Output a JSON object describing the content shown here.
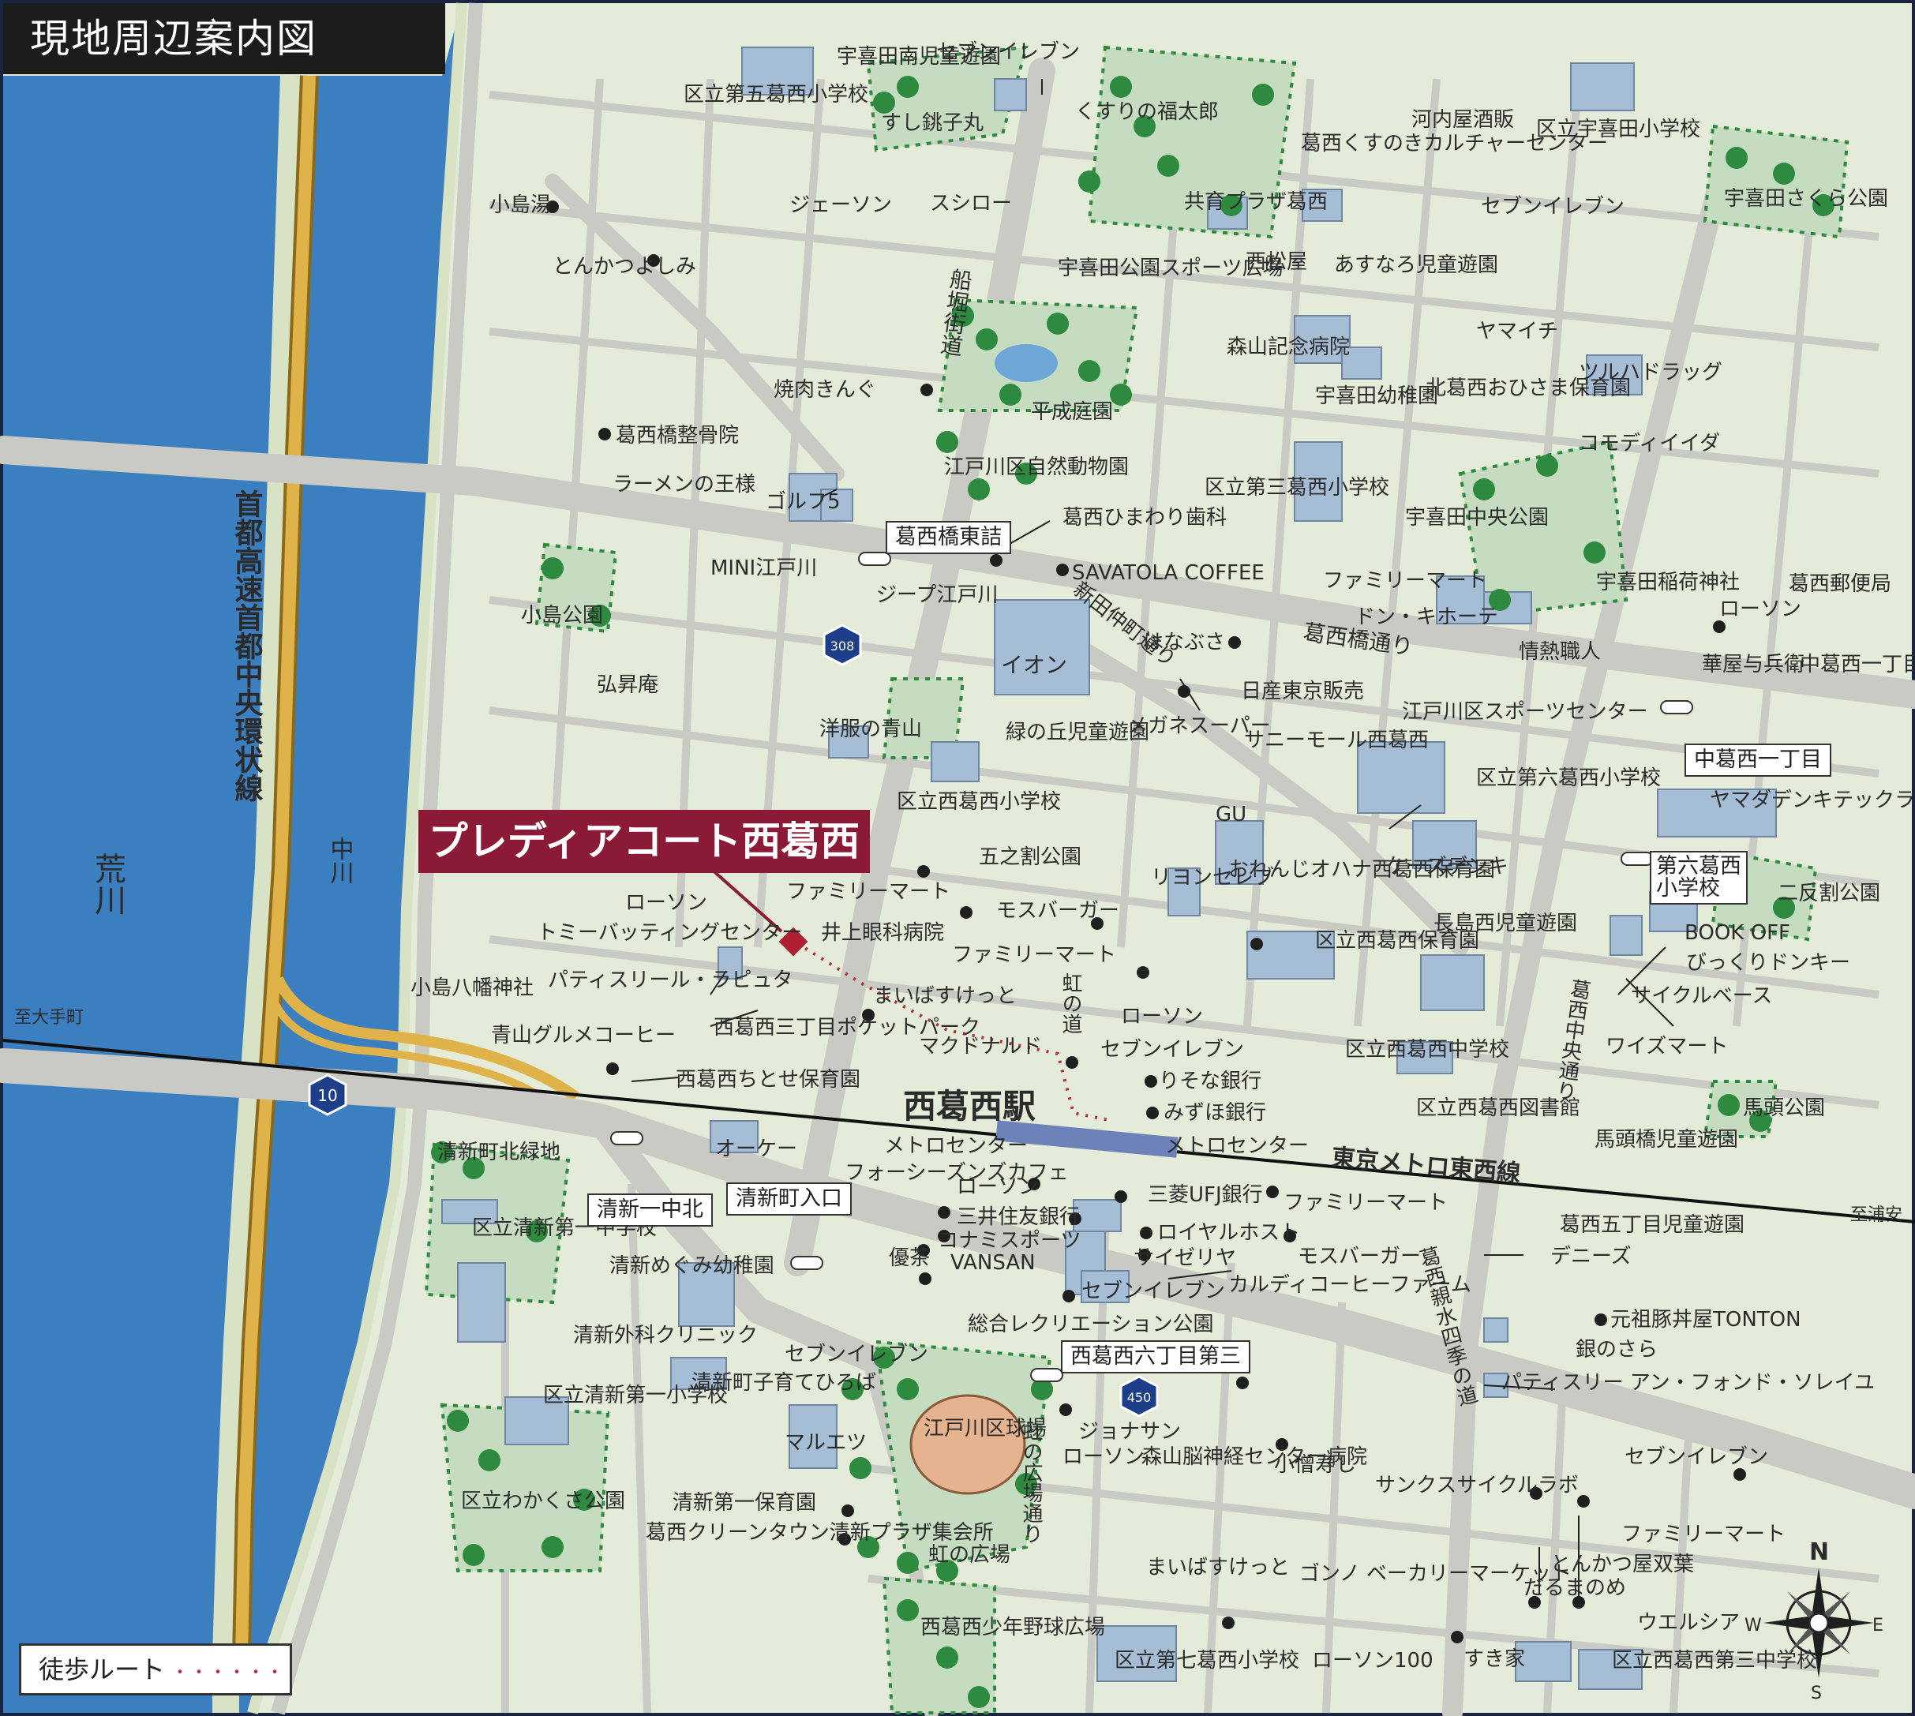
{
  "map": {
    "title": "現地周辺案内図",
    "property_name": "プレディアコート西葛西",
    "legend": {
      "label": "徒歩ルート",
      "dots": "・・・・・・"
    },
    "compass": {
      "n": "N",
      "s": "S",
      "e": "E",
      "w": "W"
    },
    "station": "西葛西駅",
    "rail_line": "東京メトロ東西線",
    "rail_dest_west": "至大手町",
    "rail_dest_east": "至浦安",
    "routes": {
      "r10": "10",
      "r308": "308",
      "r450": "450"
    },
    "colors": {
      "land": "#e4ecd9",
      "road": "#c8cac3",
      "river": "#3b7fc1",
      "highway": "#d9a93c",
      "park": "#c5dcc0",
      "tree": "#2e8a3e",
      "building": "#a6bdd6",
      "accent": "#8b1a36"
    }
  },
  "water": {
    "arakawa": "荒川",
    "nakagawa": "中川"
  },
  "roads": {
    "expressway": "首都高速首都中央環状線",
    "funaborikaido": "船堀街道",
    "shinden": "新田仲町通り",
    "kasaibashi": "葛西橋通り",
    "kasaichuo": "葛西中央通り",
    "kasaishinmizu": "葛西親水四季の道",
    "niji": "虹の道",
    "nijihiroba": "虹の広場通り"
  },
  "intersections": {
    "kasaibashi_higashi": "葛西橋東詰",
    "seishin_itchukita": "清新一中北",
    "seishincho_iriguchi": "清新町入口",
    "nishikasai6_3": "西葛西六丁目第三",
    "nakakasai1": "中葛西一丁目",
    "dairoku_kasai": "第六葛西小学校"
  },
  "labels": {
    "l01": "宇喜田南児童遊園",
    "l02": "セブンイレブン",
    "l03": "区立第五葛西小学校",
    "l04": "すし銚子丸",
    "l05": "くすりの福太郎",
    "l06": "河内屋酒販",
    "l07": "区立宇喜田小学校",
    "l08": "葛西くすのきカルチャーセンター",
    "l09": "共育プラザ葛西",
    "l10": "小島湯",
    "l11": "ジェーソン",
    "l12": "スシロー",
    "l13": "セブンイレブン",
    "l14": "宇喜田さくら公園",
    "l15": "とんかつよしみ",
    "l16": "西松屋",
    "l17": "あすなろ児童遊園",
    "l18": "宇喜田公園スポーツ広場",
    "l19": "ヤマイチ",
    "l20": "森山記念病院",
    "l21": "ツルハドラッグ",
    "l22": "焼肉きんぐ",
    "l23": "平成庭園",
    "l24": "宇喜田幼稚園",
    "l25": "北葛西おひさま保育園",
    "l26": "葛西橋整骨院",
    "l27": "コモディイイダ",
    "l28": "江戸川区自然動物園",
    "l29": "ラーメンの王様",
    "l30": "ゴルフ5",
    "l31": "区立第三葛西小学校",
    "l32": "葛西ひまわり歯科",
    "l33": "宇喜田中央公園",
    "l34": "SAVATOLA COFFEE",
    "l35": "MINI江戸川",
    "l36": "ファミリーマート",
    "l37": "宇喜田稲荷神社",
    "l38": "葛西郵便局",
    "l39": "ジープ江戸川",
    "l40": "ドン・キホーテ",
    "l41": "ローソン",
    "l42": "小島公園",
    "l43": "はなぶさ",
    "l44": "情熱職人",
    "l45": "イオン",
    "l46": "華屋与兵衛",
    "l47": "中葛西一丁目児童遊園",
    "l48": "弘昇庵",
    "l49": "日産東京販売",
    "l50": "江戸川区スポーツセンター",
    "l51": "メガネスーパー",
    "l52": "洋服の青山",
    "l53": "緑の丘児童遊園",
    "l54": "サニーモール西葛西",
    "l55": "区立第六葛西小学校",
    "l56": "ヤマダデンキテックランド",
    "l57": "区立西葛西小学校",
    "l58": "GU",
    "l59": "五之割公園",
    "l60": "ケーズデンキ",
    "l61": "二反割公園",
    "l62": "ファミリーマート",
    "l63": "リヨンセレブ",
    "l64": "おれんじオハナ西葛西保育園",
    "l65": "ローソン",
    "l66": "トミーバッティングセンター",
    "l67": "井上眼科病院",
    "l68": "モスバーガー",
    "l69": "長島西児童遊園",
    "l70": "BOOK OFF",
    "l71": "びっくりドンキー",
    "l72": "ファミリーマート",
    "l73": "区立西葛西保育園",
    "l74": "小島八幡神社",
    "l75": "パティスリール・ラピュタ",
    "l76": "サイクルベース",
    "l77": "まいばすけっと",
    "l78": "ローソン",
    "l79": "西葛西三丁目ポケットパーク",
    "l80": "セブンイレブン",
    "l81": "青山グルメコーヒー",
    "l82": "マクドナルド",
    "l83": "区立西葛西中学校",
    "l84": "ワイズマート",
    "l85": "西葛西ちとせ保育園",
    "l86": "りそな銀行",
    "l87": "みずほ銀行",
    "l88": "区立西葛西図書館",
    "l89": "馬頭公園",
    "l90": "清新町北緑地",
    "l91": "オーケー",
    "l92": "メトロセンター",
    "l93": "メトロセンター",
    "l94": "馬頭橋児童遊園",
    "l95": "フォーシーズンズカフェ",
    "l96": "ローソン",
    "l97": "三菱UFJ銀行",
    "l98": "ファミリーマート",
    "l99": "三井住友銀行",
    "l100": "葛西五丁目児童遊園",
    "l101": "区立清新第一中学校",
    "l102": "コナミスポーツ",
    "l103": "ロイヤルホスト",
    "l104": "清新めぐみ幼稚園",
    "l105": "優茶",
    "l106": "VANSAN",
    "l107": "サイゼリヤ",
    "l108": "モスバーガー",
    "l109": "デニーズ",
    "l110": "セブンイレブン",
    "l111": "カルディコーヒーファーム",
    "l112": "元祖豚丼屋TONTON",
    "l113": "総合レクリエーション公園",
    "l114": "銀のさら",
    "l115": "清新外科クリニック",
    "l116": "パティスリー アン・フォンド・ソレイユ",
    "l117": "セブンイレブン",
    "l118": "清新町子育てひろば",
    "l119": "区立清新第一小学校",
    "l120": "マルエツ",
    "l121": "江戸川区球場",
    "l122": "ジョナサン",
    "l123": "ローソン",
    "l124": "森山脳神経センター病院",
    "l125": "小僧寿し",
    "l126": "セブンイレブン",
    "l127": "区立わかくさ公園",
    "l128": "清新第一保育園",
    "l129": "サンクスサイクルラボ",
    "l130": "葛西クリーンタウン清新プラザ集会所",
    "l131": "ファミリーマート",
    "l132": "虹の広場",
    "l133": "とんかつ屋双葉",
    "l134": "まいばすけっと",
    "l135": "だるまのめ",
    "l136": "ゴンノ ベーカリーマーケット",
    "l137": "ウエルシア",
    "l138": "西葛西少年野球広場",
    "l139": "区立第七葛西小学校",
    "l140": "ローソン100",
    "l141": "すき家",
    "l142": "区立西葛西第三中学校"
  }
}
